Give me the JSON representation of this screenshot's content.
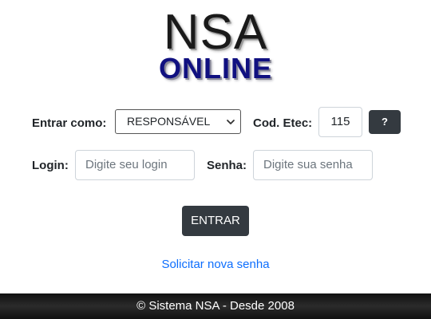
{
  "logo": {
    "line1": "NSA",
    "line2": "ONLINE"
  },
  "form": {
    "enter_as_label": "Entrar como:",
    "enter_as_value": "RESPONSÁVEL",
    "cod_label": "Cod. Etec:",
    "cod_value": "115",
    "help_label": "?",
    "login_label": "Login:",
    "login_placeholder": "Digite seu login",
    "password_label": "Senha:",
    "password_placeholder": "Digite sua senha",
    "submit_label": "ENTRAR",
    "forgot_link": "Solicitar nova senha"
  },
  "footer": {
    "text": "© Sistema NSA - Desde 2008"
  },
  "colors": {
    "dark_button": "#343a40",
    "link": "#0d6efd",
    "logo_blue": "#101080"
  },
  "icons": {
    "select_chevron": "chevron-down-icon"
  }
}
